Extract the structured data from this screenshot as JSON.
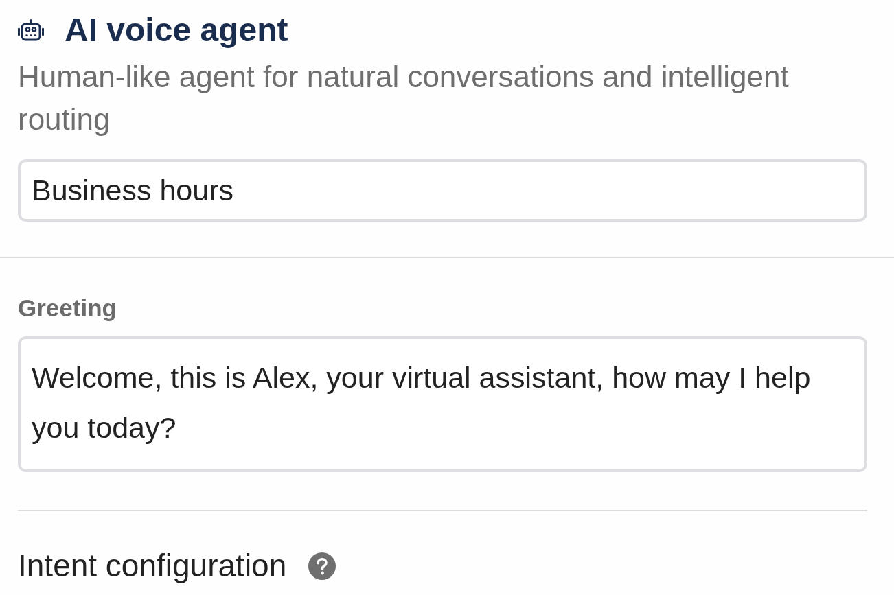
{
  "header": {
    "title": "AI voice agent",
    "subtitle": "Human-like agent for natural conversations and intelligent routing"
  },
  "name_field": {
    "value": "Business hours"
  },
  "greeting": {
    "label": "Greeting",
    "value": "Welcome, this is Alex, your virtual assistant, how may I help you today?"
  },
  "intent_configuration": {
    "title": "Intent configuration"
  }
}
